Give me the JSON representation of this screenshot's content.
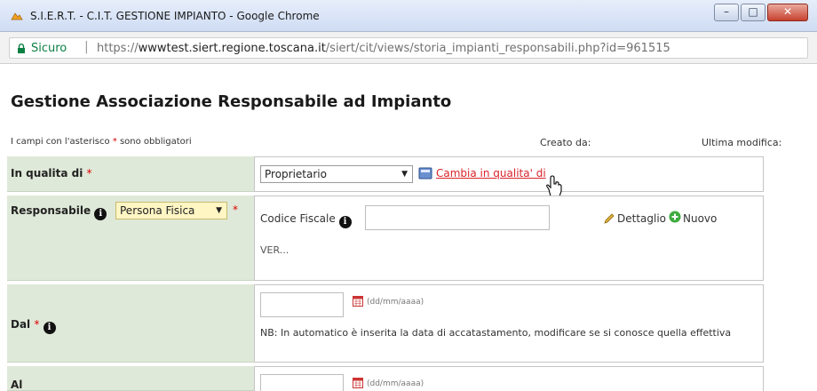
{
  "browser": {
    "title": "S.I.E.R.T. - C.I.T. GESTIONE IMPIANTO - Google Chrome",
    "secure_label": "Sicuro",
    "url_scheme": "https://",
    "url_host": "wwwtest.siert.regione.toscana.it",
    "url_path": "/siert/cit/views/storia_impianti_responsabili.php?id=961515"
  },
  "page": {
    "title": "Gestione Associazione Responsabile ad Impianto",
    "required_note_prefix": "I campi con l'asterisco ",
    "required_star": "*",
    "required_note_suffix": " sono obbligatori",
    "created_label": "Creato da:",
    "last_modified_label": "Ultima modifica:"
  },
  "form": {
    "qualita": {
      "label": "In qualita di",
      "star": "*",
      "selected": "Proprietario",
      "change_link": "Cambia in qualita' di"
    },
    "responsabile": {
      "label": "Responsabile",
      "info_glyph": "i",
      "type_selected": "Persona Fisica",
      "star": "*",
      "codice_fiscale_label": "Codice Fiscale",
      "dettaglio_label": "Dettaglio",
      "nuovo_label": "Nuovo",
      "value_text": "VER..."
    },
    "dal": {
      "label": "Dal",
      "star": "*",
      "date_hint": "(dd/mm/aaaa)",
      "note": "NB: In automatico è inserita la data di accatastamento, modificare se si conosce quella effettiva"
    },
    "al": {
      "label": "Al",
      "date_hint": "(dd/mm/aaaa)"
    }
  },
  "colors": {
    "label_bg": "#dfe9d9",
    "required": "#dd0000",
    "link": "#d8242b",
    "secure": "#0b8043"
  }
}
